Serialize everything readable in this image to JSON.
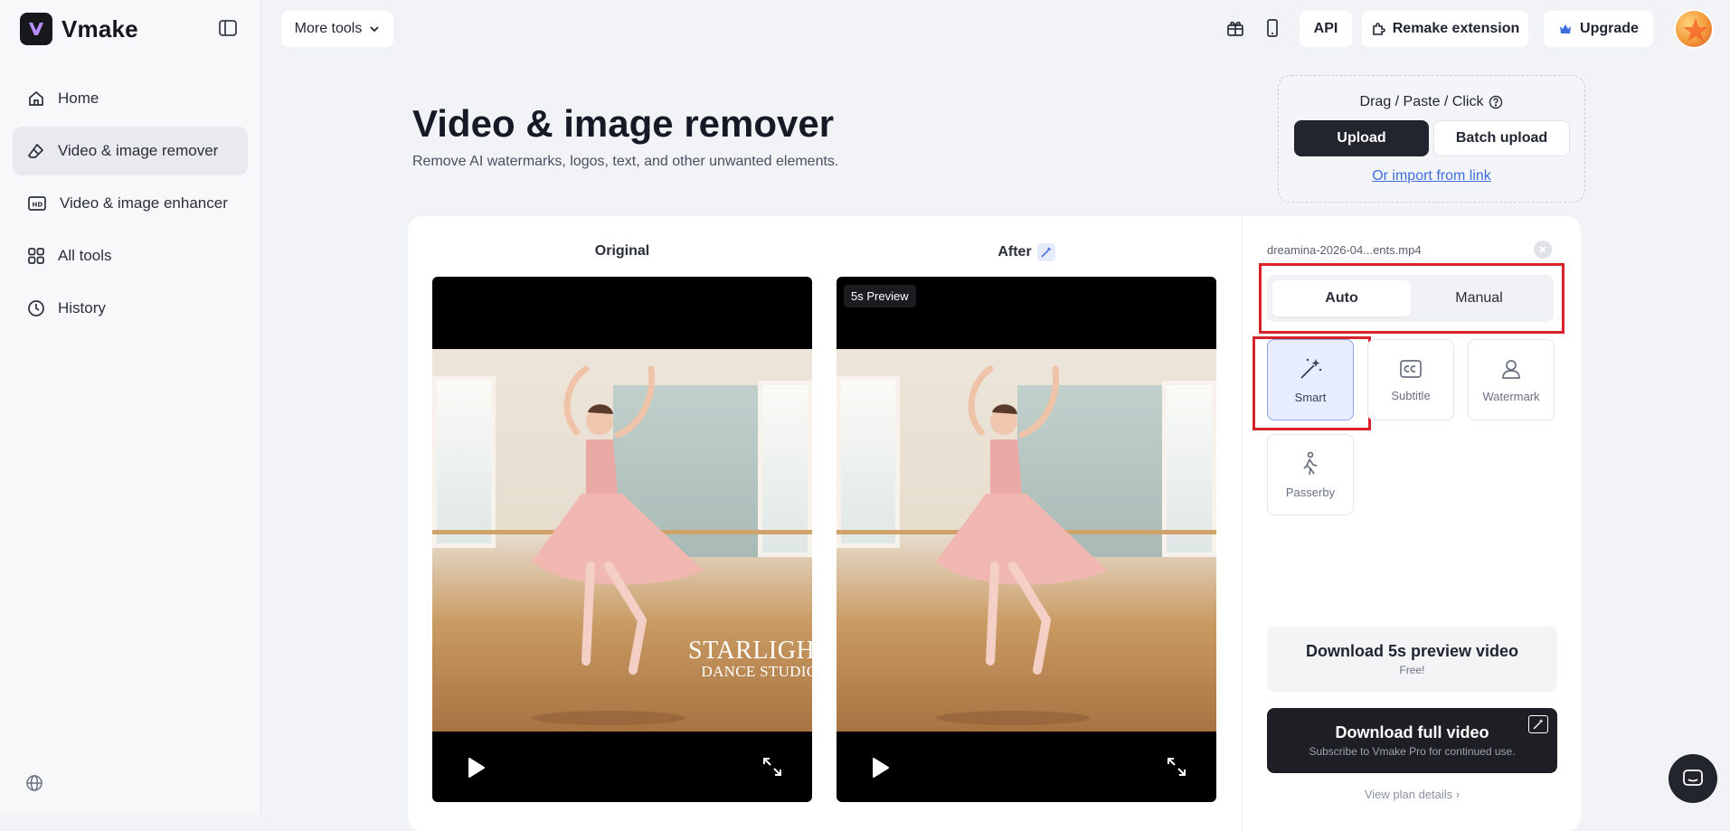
{
  "app": {
    "name": "Vmake"
  },
  "sidebar": {
    "items": [
      {
        "label": "Home",
        "icon": "home-icon",
        "active": false
      },
      {
        "label": "Video & image remover",
        "icon": "eraser-icon",
        "active": true
      },
      {
        "label": "Video & image enhancer",
        "icon": "hd-icon",
        "active": false
      },
      {
        "label": "All tools",
        "icon": "grid-icon",
        "active": false
      },
      {
        "label": "History",
        "icon": "clock-icon",
        "active": false
      }
    ]
  },
  "topbar": {
    "more_tools": "More tools",
    "api": "API",
    "remake_extension": "Remake extension",
    "upgrade": "Upgrade"
  },
  "page": {
    "title": "Video & image remover",
    "subtitle": "Remove AI watermarks, logos, text, and other unwanted elements."
  },
  "upload": {
    "hint": "Drag / Paste / Click",
    "upload_label": "Upload",
    "batch_label": "Batch upload",
    "import_link": "Or import from link"
  },
  "compare": {
    "original_label": "Original",
    "after_label": "After",
    "preview_badge": "5s Preview",
    "watermark_line1": "STARLIGHT",
    "watermark_line2": "DANCE STUDIO"
  },
  "panel": {
    "file_name": "dreamina-2026-04...ents.mp4",
    "modes": [
      "Auto",
      "Manual"
    ],
    "active_mode": "Auto",
    "tools": [
      {
        "label": "Smart",
        "icon": "magic-wand-icon",
        "active": true
      },
      {
        "label": "Subtitle",
        "icon": "subtitle-icon",
        "active": false
      },
      {
        "label": "Watermark",
        "icon": "watermark-icon",
        "active": false
      },
      {
        "label": "Passerby",
        "icon": "passerby-icon",
        "active": false
      }
    ],
    "download_preview": {
      "title": "Download 5s preview video",
      "note": "Free!"
    },
    "download_full": {
      "title": "Download full video",
      "note": "Subscribe to Vmake Pro for continued use."
    },
    "plan_link": "View plan details"
  },
  "colors": {
    "accent_blue": "#3f6de0",
    "highlight_red": "#d6222b",
    "dark_button": "#22252d"
  }
}
